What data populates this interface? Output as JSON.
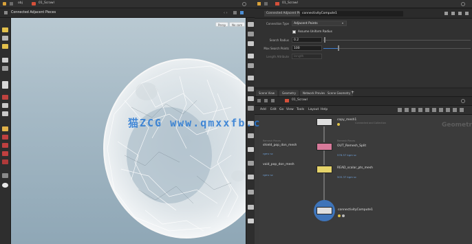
{
  "left_pane": {
    "top_tab": "obj",
    "top_path": "01_Scrawl",
    "viewer_title": "Connected Adjacent Pieces",
    "viewport_pills": [
      "Persp",
      "No cam"
    ]
  },
  "watermark": "猫ZCG www.qmxxfb.c",
  "param_pane": {
    "tab": "Connected Adjacent Pieces",
    "node_path": "connectivityCompute1",
    "rows": [
      {
        "label": "Connection Type",
        "value": "Adjacent Points"
      },
      {
        "label": "",
        "value": "Assume Uniform Radius"
      },
      {
        "label": "Search Radius",
        "value": "0.2"
      },
      {
        "label": "Max Search Points",
        "value": "100"
      },
      {
        "label": "Length Attribute",
        "value": "length"
      }
    ]
  },
  "network_pane": {
    "tabs": [
      "Scene View",
      "Geometry",
      "Network Preview",
      "Scene Geometry"
    ],
    "path": "01_Scrawl",
    "menu": [
      "Add",
      "Edit",
      "Go",
      "View",
      "Tools",
      "Layout",
      "Help"
    ],
    "context_label": "Geometry",
    "nodes": [
      {
        "name": "copy_mesh1",
        "note": "Connected and Collection"
      },
      {
        "name": "OUT_Remesh_Split",
        "sub": "576.57 kgm sc",
        "note": "Remesh Pieces"
      },
      {
        "name": "READ_scalar_pts_mesh",
        "sub": "505.37 kgm sc"
      },
      {
        "name": "connectivityCompute1",
        "sub": ""
      }
    ],
    "side_labels": [
      {
        "title": "Remesh Pieces",
        "name": "shield_pop_don_mesh",
        "sub": "rgmc sc"
      },
      {
        "title": "",
        "name": "void_pop_don_mesh",
        "sub": "rgmc sc"
      }
    ]
  },
  "colors": {
    "accent_blue": "#3f7fd0",
    "node_pink": "#d77a9a",
    "node_yellow": "#e6d46a",
    "node_white": "#dedede"
  }
}
